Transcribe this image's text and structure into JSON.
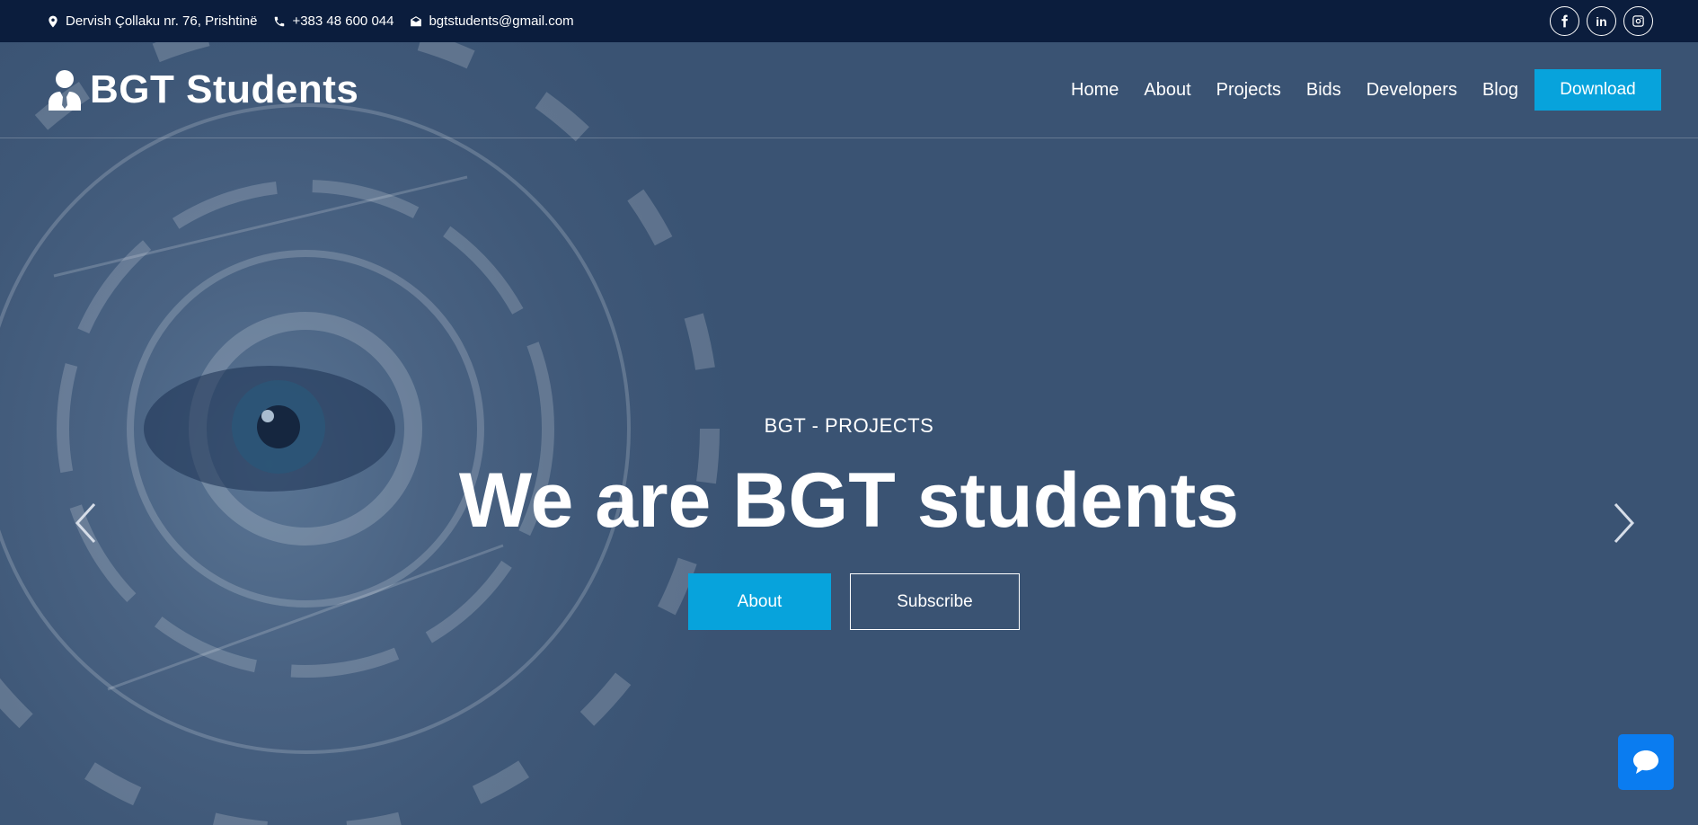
{
  "topbar": {
    "address": "Dervish Çollaku nr. 76, Prishtinë",
    "phone": "+383 48 600 044",
    "email": "bgtstudents@gmail.com",
    "socials": [
      {
        "name": "facebook",
        "icon": "facebook-icon"
      },
      {
        "name": "linkedin",
        "icon": "linkedin-icon",
        "label": "in"
      },
      {
        "name": "instagram",
        "icon": "instagram-icon"
      }
    ]
  },
  "navbar": {
    "brand": "BGT Students",
    "items": [
      "Home",
      "About",
      "Projects",
      "Bids",
      "Developers",
      "Blog"
    ],
    "download_label": "Download"
  },
  "hero": {
    "subtitle": "BGT - PROJECTS",
    "headline": "We are BGT students",
    "about_label": "About",
    "subscribe_label": "Subscribe"
  },
  "colors": {
    "topbar_bg": "#0b1d3d",
    "accent": "#07a3dc",
    "hero_overlay": "#3a5373",
    "chat": "#0a7cf0"
  }
}
